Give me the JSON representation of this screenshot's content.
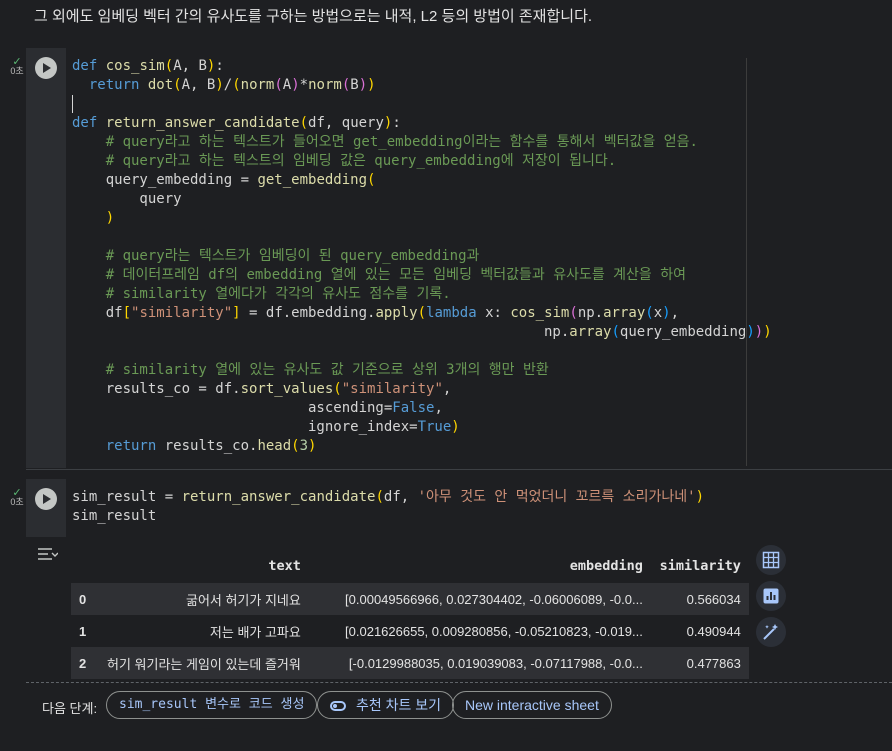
{
  "markdown": {
    "text": "그 외에도 임베딩 벡터 간의 유사도를 구하는 방법으로는 내적, L2 등의 방법이 존재합니다."
  },
  "cell1": {
    "status_check": "✓",
    "status_time": "0초",
    "code": [
      [
        [
          "kw",
          "def"
        ],
        [
          "pl",
          " "
        ],
        [
          "fn",
          "cos_sim"
        ],
        [
          "br1",
          "("
        ],
        [
          "pl",
          "A, B"
        ],
        [
          "br1",
          ")"
        ],
        [
          "pl",
          ":"
        ]
      ],
      [
        [
          "pl",
          "  "
        ],
        [
          "kw",
          "return"
        ],
        [
          "pl",
          " "
        ],
        [
          "fn",
          "dot"
        ],
        [
          "br1",
          "("
        ],
        [
          "pl",
          "A, B"
        ],
        [
          "br1",
          ")"
        ],
        [
          "pl",
          "/"
        ],
        [
          "br1",
          "("
        ],
        [
          "fn",
          "norm"
        ],
        [
          "br2",
          "("
        ],
        [
          "pl",
          "A"
        ],
        [
          "br2",
          ")"
        ],
        [
          "pl",
          "*"
        ],
        [
          "fn",
          "norm"
        ],
        [
          "br2",
          "("
        ],
        [
          "pl",
          "B"
        ],
        [
          "br2",
          ")"
        ],
        [
          "br1",
          ")"
        ]
      ],
      [
        [
          "pl",
          ""
        ]
      ],
      [
        [
          "kw",
          "def"
        ],
        [
          "pl",
          " "
        ],
        [
          "fn",
          "return_answer_candidate"
        ],
        [
          "br1",
          "("
        ],
        [
          "pl",
          "df, query"
        ],
        [
          "br1",
          ")"
        ],
        [
          "pl",
          ":"
        ]
      ],
      [
        [
          "pl",
          "    "
        ],
        [
          "cm",
          "# query라고 하는 텍스트가 들어오면 get_embedding이라는 함수를 통해서 벡터값을 얻음."
        ]
      ],
      [
        [
          "pl",
          "    "
        ],
        [
          "cm",
          "# query라고 하는 텍스트의 임베딩 값은 query_embedding에 저장이 됩니다."
        ]
      ],
      [
        [
          "pl",
          "    query_embedding = "
        ],
        [
          "fn",
          "get_embedding"
        ],
        [
          "br1",
          "("
        ]
      ],
      [
        [
          "pl",
          "        query"
        ]
      ],
      [
        [
          "pl",
          "    "
        ],
        [
          "br1",
          ")"
        ]
      ],
      [
        [
          "pl",
          ""
        ]
      ],
      [
        [
          "pl",
          "    "
        ],
        [
          "cm",
          "# query라는 텍스트가 임베딩이 된 query_embedding과"
        ]
      ],
      [
        [
          "pl",
          "    "
        ],
        [
          "cm",
          "# 데이터프레임 df의 embedding 열에 있는 모든 임베딩 벡터값들과 유사도를 계산을 하여"
        ]
      ],
      [
        [
          "pl",
          "    "
        ],
        [
          "cm",
          "# similarity 열에다가 각각의 유사도 점수를 기록."
        ]
      ],
      [
        [
          "pl",
          "    df"
        ],
        [
          "br1",
          "["
        ],
        [
          "st",
          "\"similarity\""
        ],
        [
          "br1",
          "]"
        ],
        [
          "pl",
          " = df.embedding."
        ],
        [
          "fn",
          "apply"
        ],
        [
          "br1",
          "("
        ],
        [
          "kw",
          "lambda"
        ],
        [
          "pl",
          " x: "
        ],
        [
          "fn",
          "cos_sim"
        ],
        [
          "br2",
          "("
        ],
        [
          "pl",
          "np."
        ],
        [
          "fn",
          "array"
        ],
        [
          "br3",
          "("
        ],
        [
          "pl",
          "x"
        ],
        [
          "br3",
          ")"
        ],
        [
          "pl",
          ","
        ]
      ],
      [
        [
          "pl",
          "                                                        np."
        ],
        [
          "fn",
          "array"
        ],
        [
          "br3",
          "("
        ],
        [
          "pl",
          "query_embedding"
        ],
        [
          "br3",
          ")"
        ],
        [
          "br2",
          ")"
        ],
        [
          "br1",
          ")"
        ]
      ],
      [
        [
          "pl",
          ""
        ]
      ],
      [
        [
          "pl",
          "    "
        ],
        [
          "cm",
          "# similarity 열에 있는 유사도 값 기준으로 상위 3개의 행만 반환"
        ]
      ],
      [
        [
          "pl",
          "    results_co = df."
        ],
        [
          "fn",
          "sort_values"
        ],
        [
          "br1",
          "("
        ],
        [
          "st",
          "\"similarity\""
        ],
        [
          "pl",
          ","
        ]
      ],
      [
        [
          "pl",
          "                            ascending="
        ],
        [
          "bt",
          "False"
        ],
        [
          "pl",
          ","
        ]
      ],
      [
        [
          "pl",
          "                            ignore_index="
        ],
        [
          "bt",
          "True"
        ],
        [
          "br1",
          ")"
        ]
      ],
      [
        [
          "pl",
          "    "
        ],
        [
          "kw",
          "return"
        ],
        [
          "pl",
          " results_co."
        ],
        [
          "fn",
          "head"
        ],
        [
          "br1",
          "("
        ],
        [
          "nm",
          "3"
        ],
        [
          "br1",
          ")"
        ]
      ]
    ]
  },
  "cell2": {
    "status_check": "✓",
    "status_time": "0초",
    "code": [
      [
        [
          "pl",
          "sim_result = "
        ],
        [
          "fn",
          "return_answer_candidate"
        ],
        [
          "br1",
          "("
        ],
        [
          "pl",
          "df, "
        ],
        [
          "st",
          "'아무 것도 안 먹었더니 꼬르륵 소리가나네'"
        ],
        [
          "br1",
          ")"
        ]
      ],
      [
        [
          "pl",
          "sim_result"
        ]
      ]
    ]
  },
  "output": {
    "headers": [
      "",
      "text",
      "embedding",
      "similarity"
    ],
    "rows": [
      [
        "0",
        "굶어서 허기가 지네요",
        "[0.00049566966, 0.027304402, -0.06006089, -0.0...",
        "0.566034"
      ],
      [
        "1",
        "저는 배가 고파요",
        "[0.021626655, 0.009280856, -0.05210823, -0.019...",
        "0.490944"
      ],
      [
        "2",
        "허기 워기라는 게임이 있는데 즐거워",
        "[-0.0129988035, 0.019039083, -0.07117988, -0.0...",
        "0.477863"
      ]
    ]
  },
  "next_steps": {
    "label": "다음 단계:",
    "chip1": "sim_result 변수로 코드 생성",
    "chip2": "추천 차트 보기",
    "chip3": "New interactive sheet"
  }
}
